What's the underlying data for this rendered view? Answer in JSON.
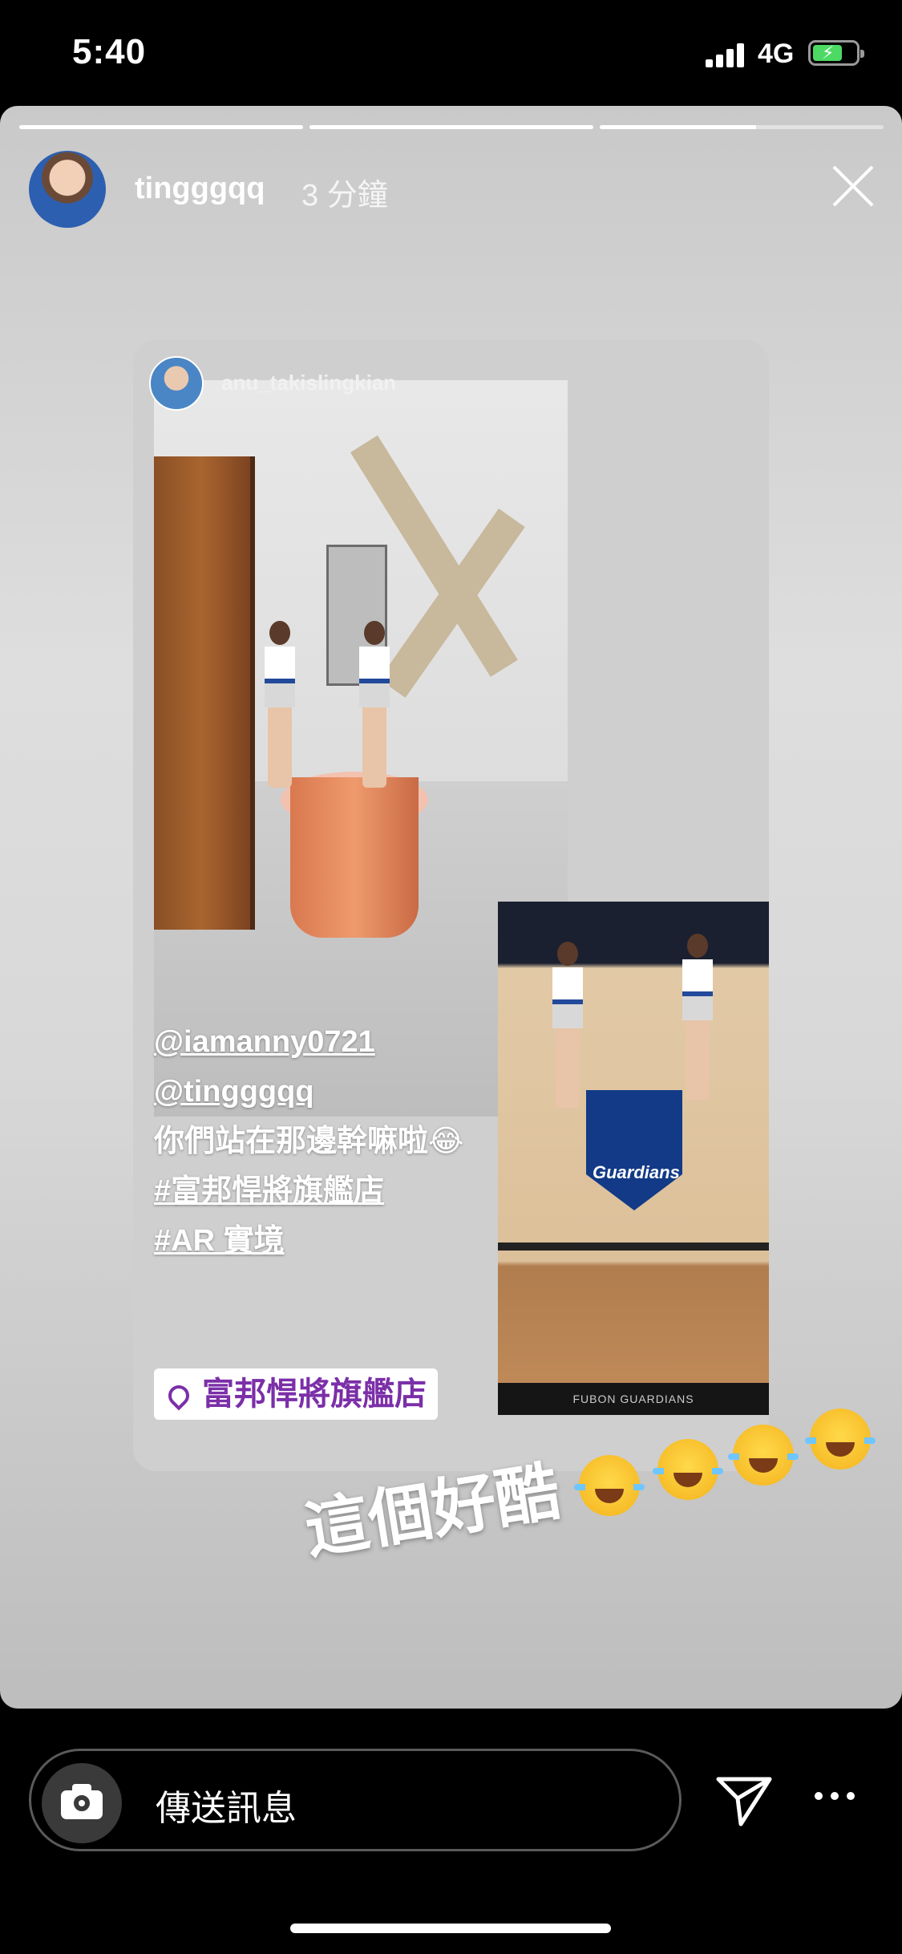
{
  "status_bar": {
    "time": "5:40",
    "network": "4G",
    "battery_charging": true
  },
  "story": {
    "progress_segments": 3,
    "progress_fraction": [
      1,
      1,
      0.55
    ],
    "username": "tingggqq",
    "time_ago": "3 分鐘",
    "shared_post": {
      "username": "anu_takislingkian",
      "caption_lines": [
        "@iamanny0721",
        "@tingggqq",
        "你們站在那邊幹嘛啦😂",
        "#富邦悍將旗艦店",
        "#AR 實境"
      ],
      "location": "富邦悍將旗艦店",
      "photo_sign": "FUBON GUARDIANS",
      "photo_badge": "Guardians"
    },
    "sticker_text": "這個好酷"
  },
  "reply_bar": {
    "placeholder": "傳送訊息"
  },
  "colors": {
    "location_text": "#7b2fa8",
    "accent_green": "#4cd964"
  }
}
